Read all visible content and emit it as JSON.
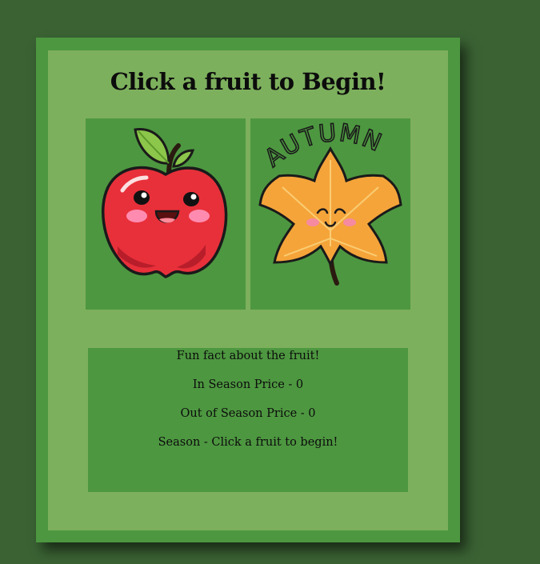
{
  "header": {
    "title": "Click a fruit to Begin!"
  },
  "fruits": [
    {
      "name": "apple",
      "icon": "apple-icon"
    },
    {
      "name": "autumn-leaf",
      "icon": "autumn-leaf-icon",
      "caption": "AUTUMN"
    }
  ],
  "info": {
    "fun_fact": "Fun fact about the fruit!",
    "in_season_price": "In Season Price - 0",
    "out_season_price": "Out of Season Price - 0",
    "season": "Season - Click a fruit to begin!"
  },
  "colors": {
    "page_background": "#3a6233",
    "card_border": "#4d9740",
    "card_fill": "#7db05d",
    "tile_fill": "#4d9740",
    "text": "#0c0c0c",
    "apple_red": "#e8303a",
    "leaf_orange": "#f5a43a"
  }
}
